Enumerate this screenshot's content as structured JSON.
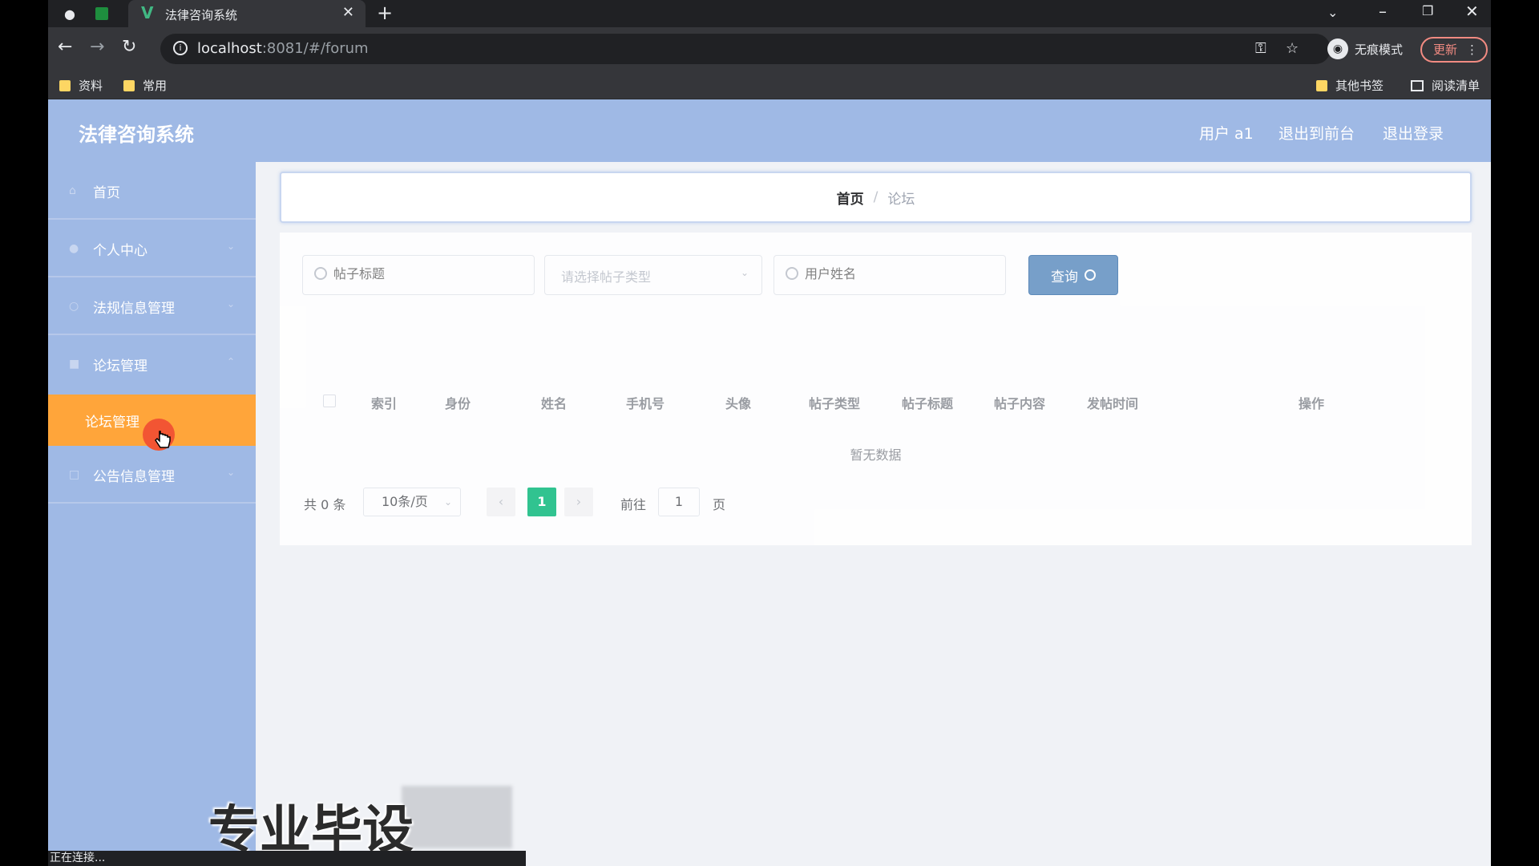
{
  "browser": {
    "tab_title": "法律咨询系统",
    "url_host": "localhost",
    "url_rest": ":8081/#/forum",
    "incognito_label": "无痕模式",
    "update_label": "更新",
    "bookmarks": [
      "资料",
      "常用"
    ],
    "other_bookmarks": "其他书签",
    "reading_list": "阅读清单",
    "status_text": "正在连接..."
  },
  "header": {
    "brand": "法律咨询系统",
    "user": "用户 a1",
    "to_front": "退出到前台",
    "logout": "退出登录"
  },
  "sidebar": {
    "items": [
      {
        "label": "首页",
        "icon": "home-icon"
      },
      {
        "label": "个人中心",
        "icon": "user-icon"
      },
      {
        "label": "法规信息管理",
        "icon": "law-icon"
      },
      {
        "label": "论坛管理",
        "icon": "forum-icon"
      },
      {
        "label": "公告信息管理",
        "icon": "notice-icon"
      }
    ],
    "active_sub": "论坛管理"
  },
  "breadcrumb": {
    "home": "首页",
    "separator": "/",
    "current": "论坛"
  },
  "search": {
    "title_placeholder": "帖子标题",
    "type_placeholder": "请选择帖子类型",
    "user_placeholder": "用户姓名",
    "query_label": "查询"
  },
  "table": {
    "columns": [
      "索引",
      "身份",
      "姓名",
      "手机号",
      "头像",
      "帖子类型",
      "帖子标题",
      "帖子内容",
      "发帖时间",
      "操作"
    ],
    "empty": "暂无数据"
  },
  "pagination": {
    "total": "共 0 条",
    "page_size": "10条/页",
    "current_page": "1",
    "goto_label": "前往",
    "goto_value": "1",
    "page_suffix": "页"
  },
  "watermark": "专业毕设",
  "colors": {
    "sidebar_bg": "#9fb9e5",
    "active_item": "#ffa53a",
    "query_button": "#6b97c5",
    "current_page": "#1dbf86"
  }
}
